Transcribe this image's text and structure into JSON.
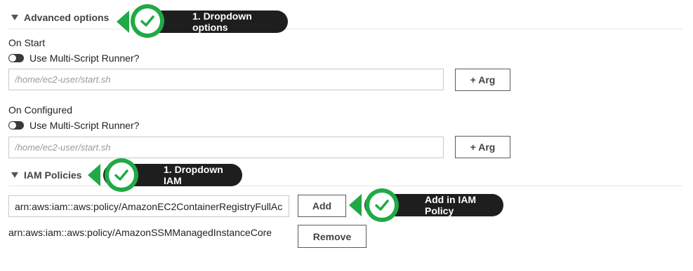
{
  "advanced": {
    "title": "Advanced options",
    "callout": "1. Dropdown options",
    "on_start": {
      "label": "On Start",
      "toggle_label": "Use Multi-Script Runner?",
      "placeholder": "/home/ec2-user/start.sh",
      "arg_button": "+ Arg"
    },
    "on_configured": {
      "label": "On Configured",
      "toggle_label": "Use Multi-Script Runner?",
      "placeholder": "/home/ec2-user/start.sh",
      "arg_button": "+ Arg"
    }
  },
  "iam": {
    "title": "IAM Policies",
    "callout": "1. Dropdown IAM",
    "input_value": "arn:aws:iam::aws:policy/AmazonEC2ContainerRegistryFullAc",
    "add_button": "Add",
    "add_callout": "Add in IAM Policy",
    "policies": [
      {
        "arn": "arn:aws:iam::aws:policy/AmazonSSMManagedInstanceCore",
        "remove_label": "Remove"
      }
    ]
  },
  "colors": {
    "callout_bg": "#1e1e1e",
    "badge_green": "#1faa45"
  },
  "icons": {
    "collapse": "triangle-down-icon",
    "callout_badge": "checkmark-icon"
  }
}
